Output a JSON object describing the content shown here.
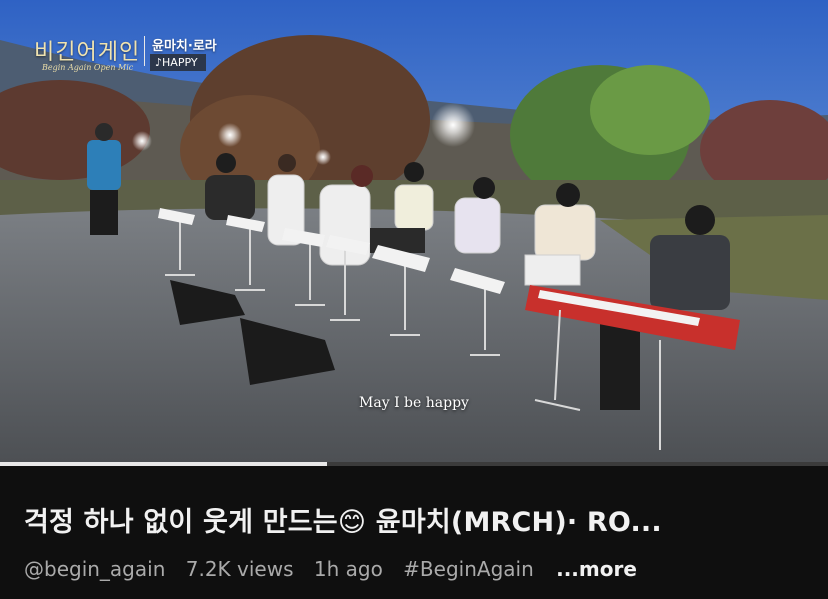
{
  "video": {
    "logo_text": "비긴어게인",
    "logo_subtext": "Begin Again Open Mic",
    "guest_label": "윤마치·로라",
    "song_tag": "♪HAPPY",
    "subtitle": "May I be happy",
    "progress": 0.395
  },
  "info": {
    "title": "걱정 하나 없이 웃게 만드는😊 윤마치(MRCH)· RO...",
    "channel": "@begin_again",
    "views": "7.2K views",
    "age": "1h ago",
    "hashtag": "#BeginAgain",
    "more_label": "...more"
  }
}
